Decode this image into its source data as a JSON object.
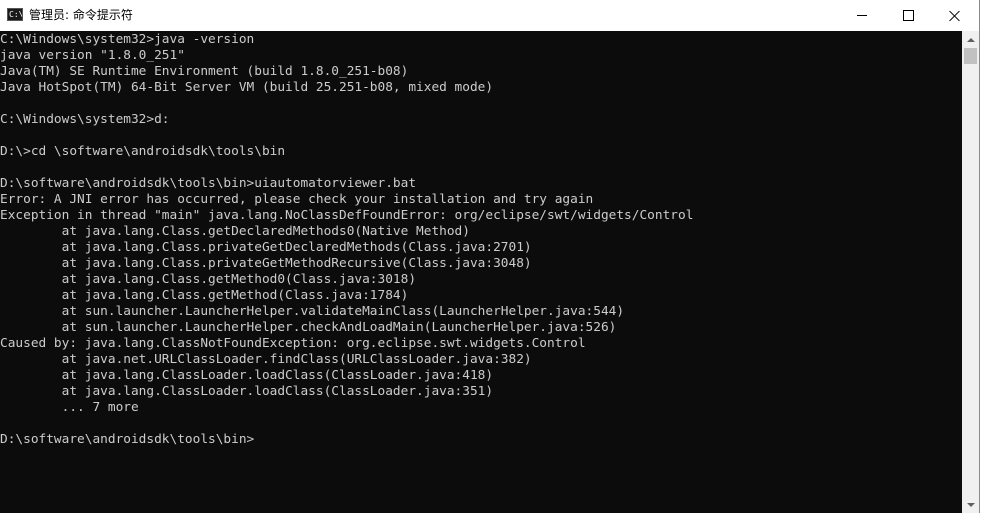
{
  "window": {
    "title": "管理员: 命令提示符",
    "icon_label": "C:\\",
    "icon": "cmd-icon"
  },
  "controls": {
    "minimize_icon": "minimize-icon",
    "maximize_icon": "maximize-icon",
    "close_icon": "close-icon"
  },
  "console": {
    "lines": [
      "C:\\Windows\\system32>java -version",
      "java version \"1.8.0_251\"",
      "Java(TM) SE Runtime Environment (build 1.8.0_251-b08)",
      "Java HotSpot(TM) 64-Bit Server VM (build 25.251-b08, mixed mode)",
      "",
      "C:\\Windows\\system32>d:",
      "",
      "D:\\>cd \\software\\androidsdk\\tools\\bin",
      "",
      "D:\\software\\androidsdk\\tools\\bin>uiautomatorviewer.bat",
      "Error: A JNI error has occurred, please check your installation and try again",
      "Exception in thread \"main\" java.lang.NoClassDefFoundError: org/eclipse/swt/widgets/Control",
      "        at java.lang.Class.getDeclaredMethods0(Native Method)",
      "        at java.lang.Class.privateGetDeclaredMethods(Class.java:2701)",
      "        at java.lang.Class.privateGetMethodRecursive(Class.java:3048)",
      "        at java.lang.Class.getMethod0(Class.java:3018)",
      "        at java.lang.Class.getMethod(Class.java:1784)",
      "        at sun.launcher.LauncherHelper.validateMainClass(LauncherHelper.java:544)",
      "        at sun.launcher.LauncherHelper.checkAndLoadMain(LauncherHelper.java:526)",
      "Caused by: java.lang.ClassNotFoundException: org.eclipse.swt.widgets.Control",
      "        at java.net.URLClassLoader.findClass(URLClassLoader.java:382)",
      "        at java.lang.ClassLoader.loadClass(ClassLoader.java:418)",
      "        at java.lang.ClassLoader.loadClass(ClassLoader.java:351)",
      "        ... 7 more",
      "",
      "D:\\software\\androidsdk\\tools\\bin>"
    ]
  },
  "scrollbar": {
    "up_icon": "scroll-up-arrow-icon",
    "down_icon": "scroll-down-arrow-icon"
  },
  "colors": {
    "console_background": "#0c0c0c",
    "console_text": "#cccccc",
    "titlebar_background": "#ffffff"
  }
}
